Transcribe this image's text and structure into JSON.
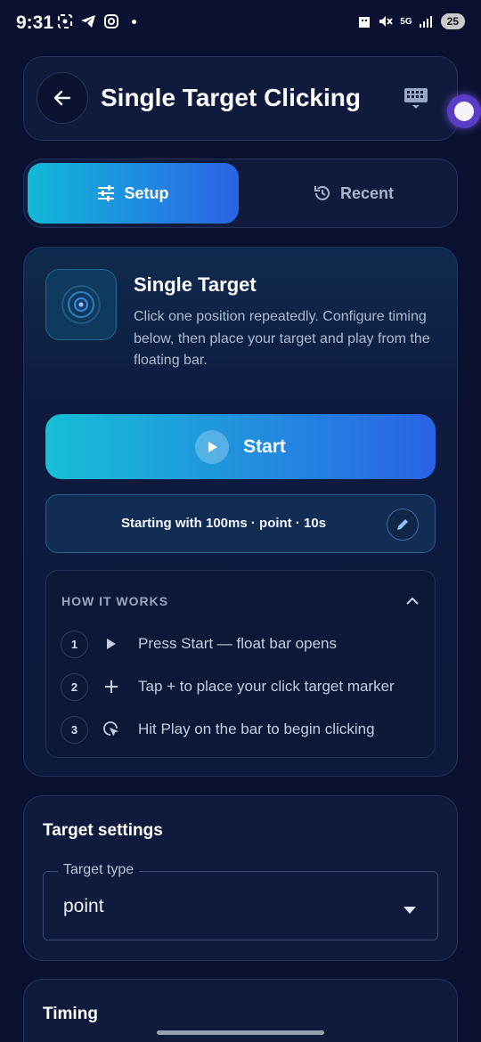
{
  "status_bar": {
    "time": "9:31",
    "battery": "25",
    "network": "5G"
  },
  "header": {
    "title": "Single Target Clicking"
  },
  "tabs": [
    {
      "label": "Setup",
      "active": true,
      "icon": "sliders-icon"
    },
    {
      "label": "Recent",
      "active": false,
      "icon": "history-icon"
    }
  ],
  "mode": {
    "title": "Single Target",
    "description": "Click one position repeatedly. Configure timing below, then place your target and play from the floating bar."
  },
  "start_button": {
    "label": "Start"
  },
  "summary": {
    "text": "Starting with 100ms · point · 10s"
  },
  "how_it_works": {
    "title": "HOW IT WORKS",
    "steps": [
      {
        "number": "1",
        "icon": "play-icon",
        "text": "Press Start — float bar opens"
      },
      {
        "number": "2",
        "icon": "plus-icon",
        "text": "Tap + to place your click target marker"
      },
      {
        "number": "3",
        "icon": "click-cursor-icon",
        "text": "Hit Play on the bar to begin clicking"
      }
    ]
  },
  "target_settings": {
    "title": "Target settings",
    "target_type": {
      "label": "Target type",
      "value": "point"
    }
  },
  "timing": {
    "title": "Timing"
  },
  "colors": {
    "background": "#0a1030",
    "card": "#0f1a3c",
    "accent_start": "#12b9d8",
    "accent_end": "#2a63e6"
  }
}
